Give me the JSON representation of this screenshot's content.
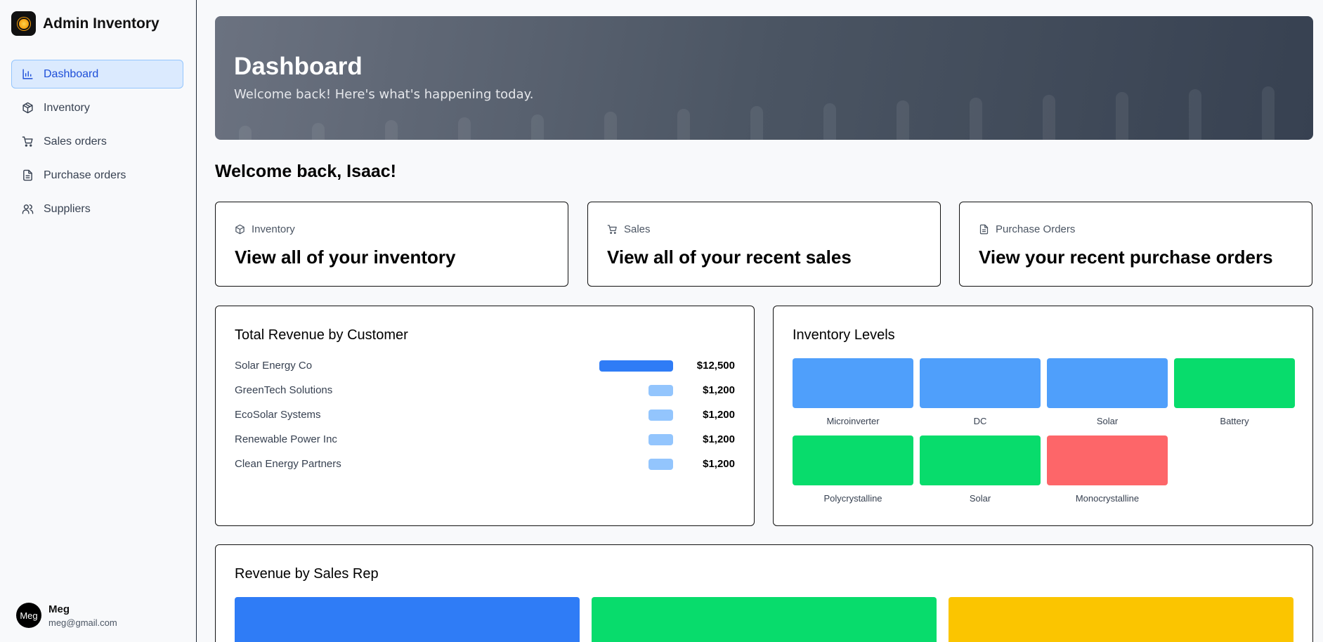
{
  "brand": {
    "title": "Admin Inventory",
    "logo_icon": "sun-icon"
  },
  "sidebar": {
    "items": [
      {
        "label": "Dashboard",
        "icon": "bar-chart-icon",
        "active": true
      },
      {
        "label": "Inventory",
        "icon": "package-icon",
        "active": false
      },
      {
        "label": "Sales orders",
        "icon": "cart-icon",
        "active": false
      },
      {
        "label": "Purchase orders",
        "icon": "document-icon",
        "active": false
      },
      {
        "label": "Suppliers",
        "icon": "users-icon",
        "active": false
      }
    ]
  },
  "user": {
    "avatar_text": "Meg",
    "name": "Meg",
    "email": "meg@gmail.com"
  },
  "hero": {
    "title": "Dashboard",
    "subtitle": "Welcome back! Here's what's happening today."
  },
  "welcome": "Welcome back, Isaac!",
  "quick_cards": [
    {
      "label": "Inventory",
      "icon": "package-icon",
      "title": "View all of your inventory"
    },
    {
      "label": "Sales",
      "icon": "cart-icon",
      "title": "View all of your recent sales"
    },
    {
      "label": "Purchase Orders",
      "icon": "document-icon",
      "title": "View your recent purchase orders"
    }
  ],
  "revenue_by_customer": {
    "title": "Total Revenue by Customer",
    "rows": [
      {
        "name": "Solar Energy Co",
        "value": 12500,
        "display": "$12,500",
        "color": "#2f7cf6"
      },
      {
        "name": "GreenTech Solutions",
        "value": 1200,
        "display": "$1,200",
        "color": "#93c5fd"
      },
      {
        "name": "EcoSolar Systems",
        "value": 1200,
        "display": "$1,200",
        "color": "#93c5fd"
      },
      {
        "name": "Renewable Power Inc",
        "value": 1200,
        "display": "$1,200",
        "color": "#93c5fd"
      },
      {
        "name": "Clean Energy Partners",
        "value": 1200,
        "display": "$1,200",
        "color": "#93c5fd"
      }
    ]
  },
  "inventory_levels": {
    "title": "Inventory Levels",
    "items": [
      {
        "label": "Microinverter",
        "color": "#4f9ffb"
      },
      {
        "label": "DC",
        "color": "#4f9ffb"
      },
      {
        "label": "Solar",
        "color": "#4f9ffb"
      },
      {
        "label": "Battery",
        "color": "#08dc6c"
      },
      {
        "label": "Polycrystalline",
        "color": "#08dc6c"
      },
      {
        "label": "Solar",
        "color": "#08dc6c"
      },
      {
        "label": "Monocrystalline",
        "color": "#fd6669"
      }
    ]
  },
  "revenue_by_rep": {
    "title": "Revenue by Sales Rep",
    "colors": [
      "#2f7cf6",
      "#08dc6c",
      "#fbc500"
    ]
  }
}
